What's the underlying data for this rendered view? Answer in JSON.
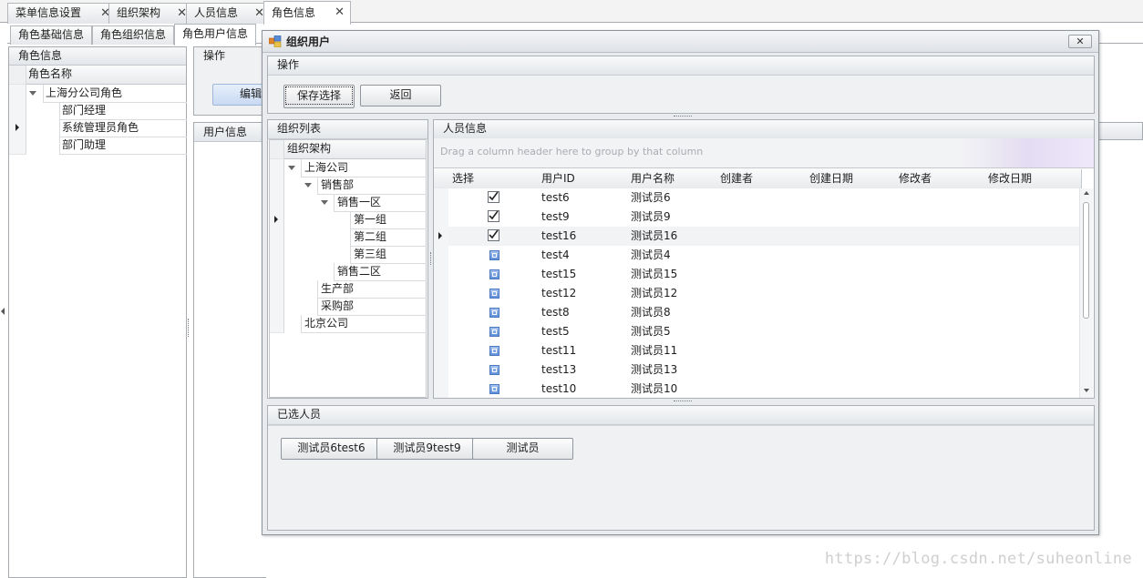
{
  "doc_tabs": [
    {
      "label": "菜单信息设置"
    },
    {
      "label": "组织架构"
    },
    {
      "label": "人员信息"
    },
    {
      "label": "角色信息"
    }
  ],
  "close_glyph": "✕",
  "sub_tabs": [
    {
      "label": "角色基础信息"
    },
    {
      "label": "角色组织信息"
    },
    {
      "label": "角色用户信息"
    }
  ],
  "left_panel": {
    "title": "角色信息",
    "column": "角色名称",
    "root": "上海分公司角色",
    "items": [
      "部门经理",
      "系统管理员角色",
      "部门助理"
    ]
  },
  "background": {
    "op_title": "操作",
    "edit_label": "编辑",
    "user_title": "用户信息"
  },
  "dialog": {
    "title": "组织用户",
    "op_title": "操作",
    "save_label": "保存选择",
    "back_label": "返回",
    "org_list_title": "组织列表",
    "org_column": "组织架构",
    "org_tree": [
      "上海公司",
      "销售部",
      "销售一区",
      "第一组",
      "第二组",
      "第三组",
      "销售二区",
      "生产部",
      "采购部",
      "北京公司"
    ],
    "staff_title": "人员信息",
    "group_hint": "Drag a column header here to group by that column",
    "columns": [
      "选择",
      "用户ID",
      "用户名称",
      "创建者",
      "创建日期",
      "修改者",
      "修改日期"
    ],
    "rows": [
      {
        "id": "test6",
        "name": "测试员6",
        "checked": true
      },
      {
        "id": "test9",
        "name": "测试员9",
        "checked": true
      },
      {
        "id": "test16",
        "name": "测试员16",
        "checked": true
      },
      {
        "id": "test4",
        "name": "测试员4",
        "checked": false
      },
      {
        "id": "test15",
        "name": "测试员15",
        "checked": false
      },
      {
        "id": "test12",
        "name": "测试员12",
        "checked": false
      },
      {
        "id": "test8",
        "name": "测试员8",
        "checked": false
      },
      {
        "id": "test5",
        "name": "测试员5",
        "checked": false
      },
      {
        "id": "test11",
        "name": "测试员11",
        "checked": false
      },
      {
        "id": "test13",
        "name": "测试员13",
        "checked": false
      },
      {
        "id": "test10",
        "name": "测试员10",
        "checked": false
      }
    ],
    "selected_title": "已选人员",
    "selected_people": [
      "测试员6test6",
      "测试员9test9",
      "测试员"
    ]
  },
  "watermark": "https://blog.csdn.net/suheonline",
  "colors": {
    "accent": "#4a78c2",
    "panel_bg": "#f0f1f3",
    "border": "#a7abb0"
  }
}
